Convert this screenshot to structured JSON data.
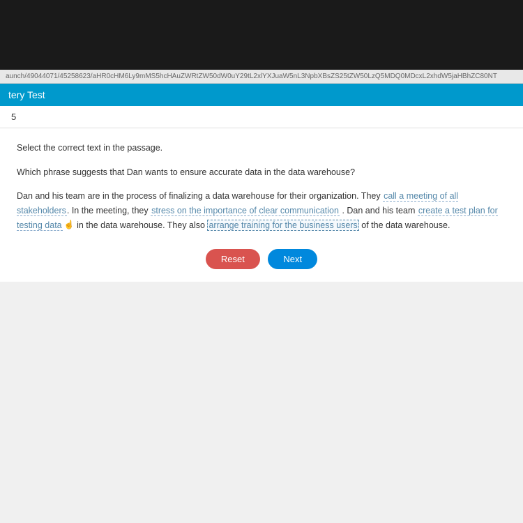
{
  "url": "aunch/49044071/45258623/aHR0cHM6Ly9mMS5hcHAuZWRtZW50dW0uY29tL2xlYXJuaW5nL3NpbXBsZS25tZW50LzQ5MDQ0MDcxL2xhdW5jaHBhZC80NT",
  "header": {
    "title": "tery Test"
  },
  "question": {
    "number": "5",
    "instruction": "Select the correct text in the passage.",
    "prompt": "Which phrase suggests that Dan wants to ensure accurate data in the data warehouse?",
    "passage": {
      "t1": "Dan and his team are in the process of finalizing a data warehouse for their organization. They ",
      "s1": "call a meeting of all stakeholders",
      "t2": ". In the meeting, they ",
      "s2": "stress on the importance of clear communication",
      "t3": " . Dan and his team ",
      "s3": "create a test plan for testing data",
      "t4": " in the data warehouse. They also ",
      "s4": "arrange training for the business users",
      "t5": " of the data warehouse."
    }
  },
  "buttons": {
    "reset": "Reset",
    "next": "Next"
  }
}
